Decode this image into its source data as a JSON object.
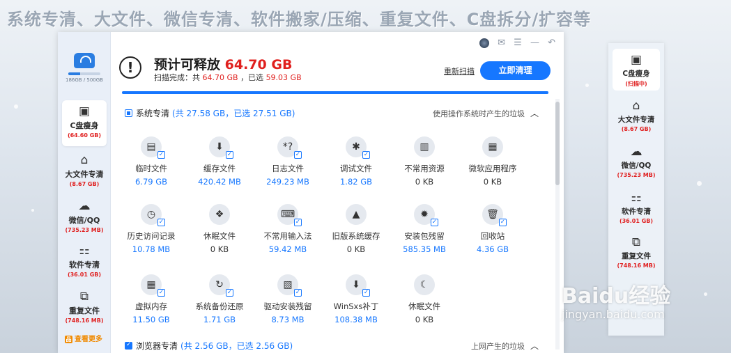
{
  "banner": "系统专清、大文件、微信专清、软件搬家/压缩、重复文件、C盘拆分/扩容等",
  "disk": {
    "usage_text": "186GB / 500GB",
    "usage_fraction": 0.372
  },
  "left_nav": {
    "items": [
      {
        "label": "C盘瘦身",
        "size": "(64.60 GB)",
        "icon": "▣"
      },
      {
        "label": "大文件专清",
        "size": "(8.67 GB)",
        "icon": "⌂"
      },
      {
        "label": "微信/QQ",
        "size": "(735.23 MB)",
        "icon": "☁"
      },
      {
        "label": "软件专清",
        "size": "(36.01 GB)",
        "icon": "⚏"
      },
      {
        "label": "重复文件",
        "size": "(748.16 MB)",
        "icon": "⧉"
      }
    ],
    "see_more": "查看更多",
    "see_more_badge": "品"
  },
  "title_controls": [
    "✉",
    "☰",
    "—",
    "↶"
  ],
  "summary": {
    "title_prefix": "预计可释放",
    "title_value": "64.70 GB",
    "sub_prefix": "扫描完成：共",
    "sub_total": "64.70 GB",
    "sub_mid": "，已选",
    "sub_selected": "59.03 GB"
  },
  "actions": {
    "rescan": "重新扫描",
    "clean": "立即清理"
  },
  "scan_progress": 1.0,
  "section_system": {
    "title": "系统专清",
    "stat": "(共 27.58 GB，已选 27.51 GB)",
    "desc": "使用操作系统时产生的垃圾",
    "items": [
      {
        "name": "临时文件",
        "size": "6.79 GB",
        "icon": "▤",
        "checked": true
      },
      {
        "name": "缓存文件",
        "size": "420.42 MB",
        "icon": "⬇",
        "checked": true
      },
      {
        "name": "日志文件",
        "size": "249.23 MB",
        "icon": "*?",
        "checked": true
      },
      {
        "name": "调试文件",
        "size": "1.82 GB",
        "icon": "✱",
        "checked": true
      },
      {
        "name": "不常用资源",
        "size": "0 KB",
        "icon": "▥",
        "checked": false
      },
      {
        "name": "微软应用程序",
        "size": "0 KB",
        "icon": "▦",
        "checked": false
      },
      {
        "name": "历史访问记录",
        "size": "10.78 MB",
        "icon": "◷",
        "checked": true
      },
      {
        "name": "休眠文件",
        "size": "0 KB",
        "icon": "❖",
        "checked": false
      },
      {
        "name": "不常用输入法",
        "size": "59.42 MB",
        "icon": "⌨",
        "checked": true
      },
      {
        "name": "旧版系统缓存",
        "size": "0 KB",
        "icon": "▲",
        "checked": false
      },
      {
        "name": "安装包残留",
        "size": "585.35 MB",
        "icon": "✹",
        "checked": true
      },
      {
        "name": "回收站",
        "size": "4.36 GB",
        "icon": "🗑",
        "checked": true
      },
      {
        "name": "虚拟内存",
        "size": "11.50 GB",
        "icon": "▦",
        "checked": true
      },
      {
        "name": "系统备份还原",
        "size": "1.71 GB",
        "icon": "↻",
        "checked": true
      },
      {
        "name": "驱动安装残留",
        "size": "8.73 MB",
        "icon": "▧",
        "checked": true
      },
      {
        "name": "WinSxs补丁",
        "size": "108.38 MB",
        "icon": "⬇",
        "checked": true
      },
      {
        "name": "休眠文件",
        "size": "0 KB",
        "icon": "☾",
        "checked": false
      }
    ]
  },
  "section_browser": {
    "title": "浏览器专清",
    "stat": "(共 2.56 GB，已选 2.56 GB)",
    "desc": "上网产生的垃圾"
  },
  "right_panel": {
    "items": [
      {
        "label": "C盘瘦身",
        "size": "(扫描中)",
        "icon": "▣"
      },
      {
        "label": "大文件专清",
        "size": "(8.67 GB)",
        "icon": "⌂"
      },
      {
        "label": "微信/QQ",
        "size": "(735.23 MB)",
        "icon": "☁"
      },
      {
        "label": "软件专清",
        "size": "(36.01 GB)",
        "icon": "⚏"
      },
      {
        "label": "重复文件",
        "size": "(748.16 MB)",
        "icon": "⧉"
      }
    ]
  },
  "watermark": {
    "brand": "Baidu经验",
    "url": "jingyan.baidu.com"
  },
  "colors": {
    "accent": "#1677ff",
    "danger": "#e0201e",
    "warn": "#f08a00"
  }
}
